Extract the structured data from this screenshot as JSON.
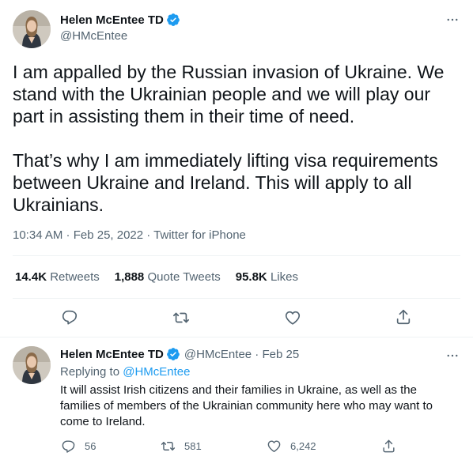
{
  "main_tweet": {
    "author_name": "Helen McEntee TD",
    "author_handle": "@HMcEntee",
    "text_lines_p1": [
      "I am appalled by the Russian invasion of Ukraine. We",
      "stand with the Ukrainian people and we will play our",
      "part in assisting them in their time of need."
    ],
    "text_lines_p2": [
      "That’s why I am immediately lifting visa requirements",
      "between Ukraine and Ireland. This will apply to all",
      "Ukrainians."
    ],
    "meta": "10:34 AM · Feb 25, 2022 · Twitter for iPhone",
    "stats": {
      "retweets_count": "14.4K",
      "retweets_label": "Retweets",
      "quotes_count": "1,888",
      "quotes_label": "Quote Tweets",
      "likes_count": "95.8K",
      "likes_label": "Likes"
    },
    "actions": [
      "reply-icon",
      "retweet-icon",
      "like-icon",
      "share-icon"
    ]
  },
  "reply_tweet": {
    "author_name": "Helen McEntee TD",
    "author_handle": "@HMcEntee · Feb 25",
    "replying_prefix": "Replying to",
    "replying_to": "@HMcEntee",
    "text_lines": [
      "It will assist Irish citizens and their families in Ukraine, as well as the",
      "families of members of the Ukrainian community here who may want to",
      "come to Ireland."
    ],
    "reply_count": "56",
    "retweet_count": "581",
    "like_count": "6,242"
  },
  "colors": {
    "text": "#0f1419",
    "secondary": "#536471",
    "accent": "#1d9bf0",
    "divider": "#eff3f4"
  }
}
